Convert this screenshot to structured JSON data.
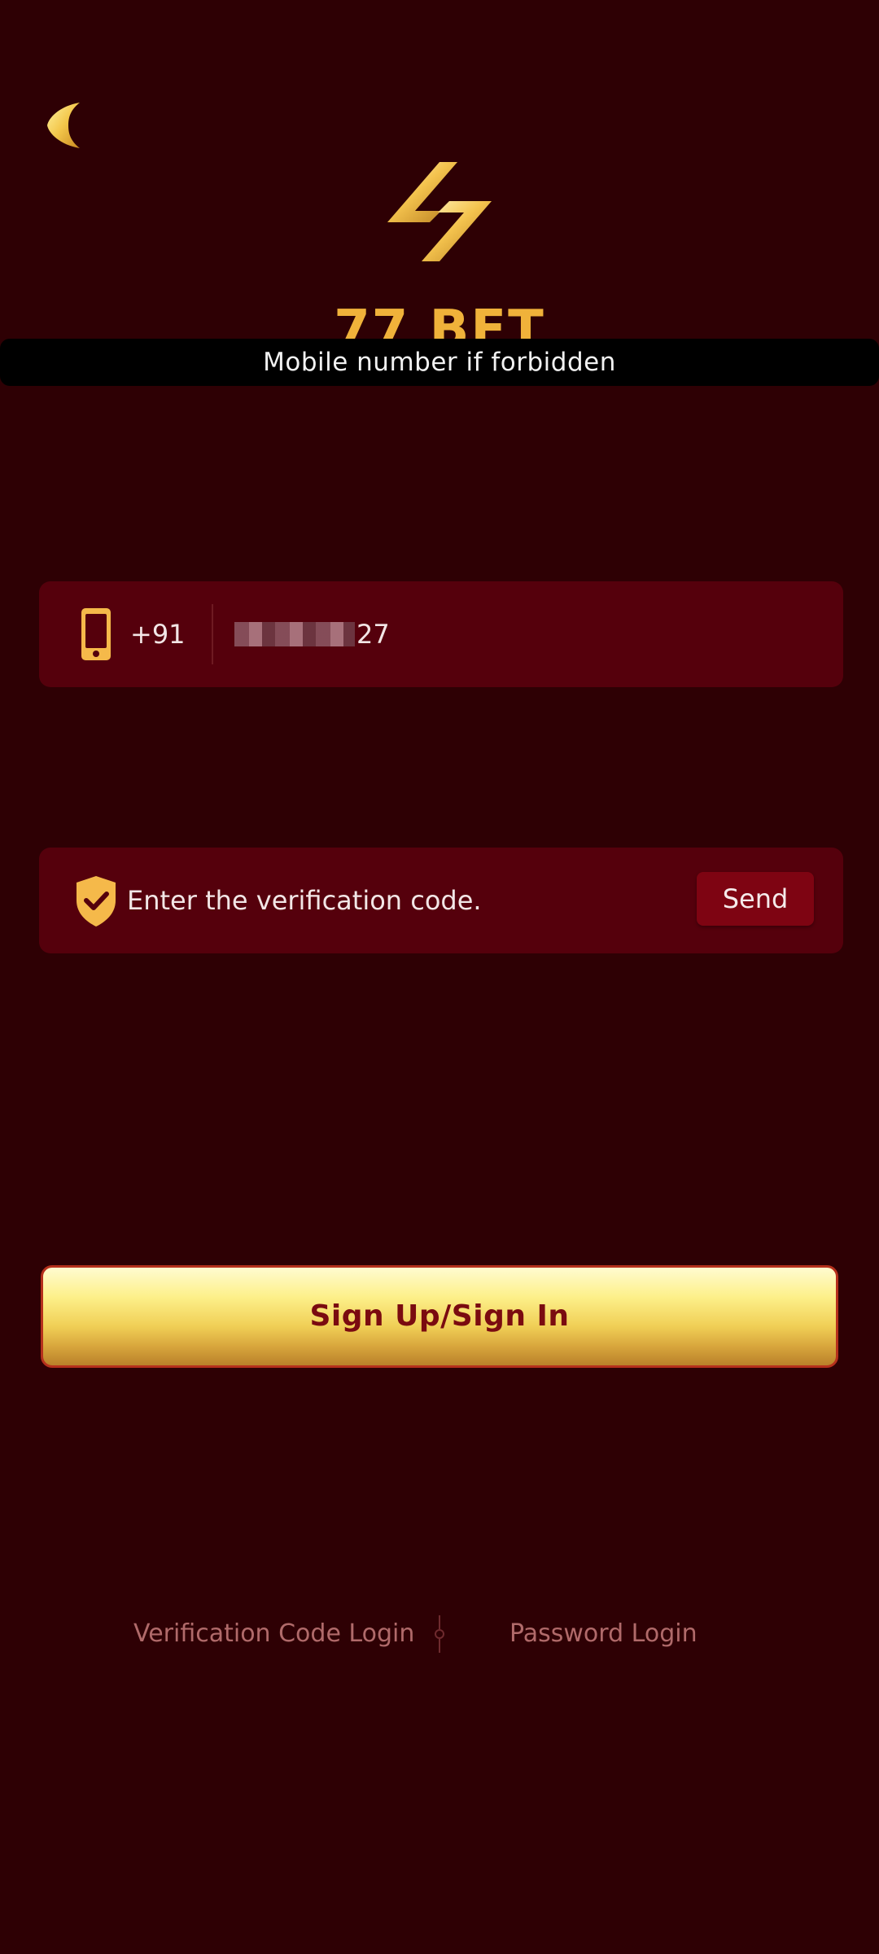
{
  "brand": {
    "name": "77 BET",
    "gold": "#f0b23a"
  },
  "toast": {
    "message": "Mobile number if forbidden"
  },
  "phone_field": {
    "icon": "phone-icon",
    "country_code": "+91",
    "value_visible_suffix": "27"
  },
  "code_field": {
    "icon": "shield-check-icon",
    "placeholder": "Enter the verification code.",
    "send_label": "Send"
  },
  "primary_action": {
    "label": "Sign Up/Sign In"
  },
  "login_modes": {
    "verification": "Verification Code Login",
    "password": "Password Login"
  },
  "colors": {
    "background": "#2e0004",
    "field": "#55000c",
    "send_button": "#7e0412"
  }
}
